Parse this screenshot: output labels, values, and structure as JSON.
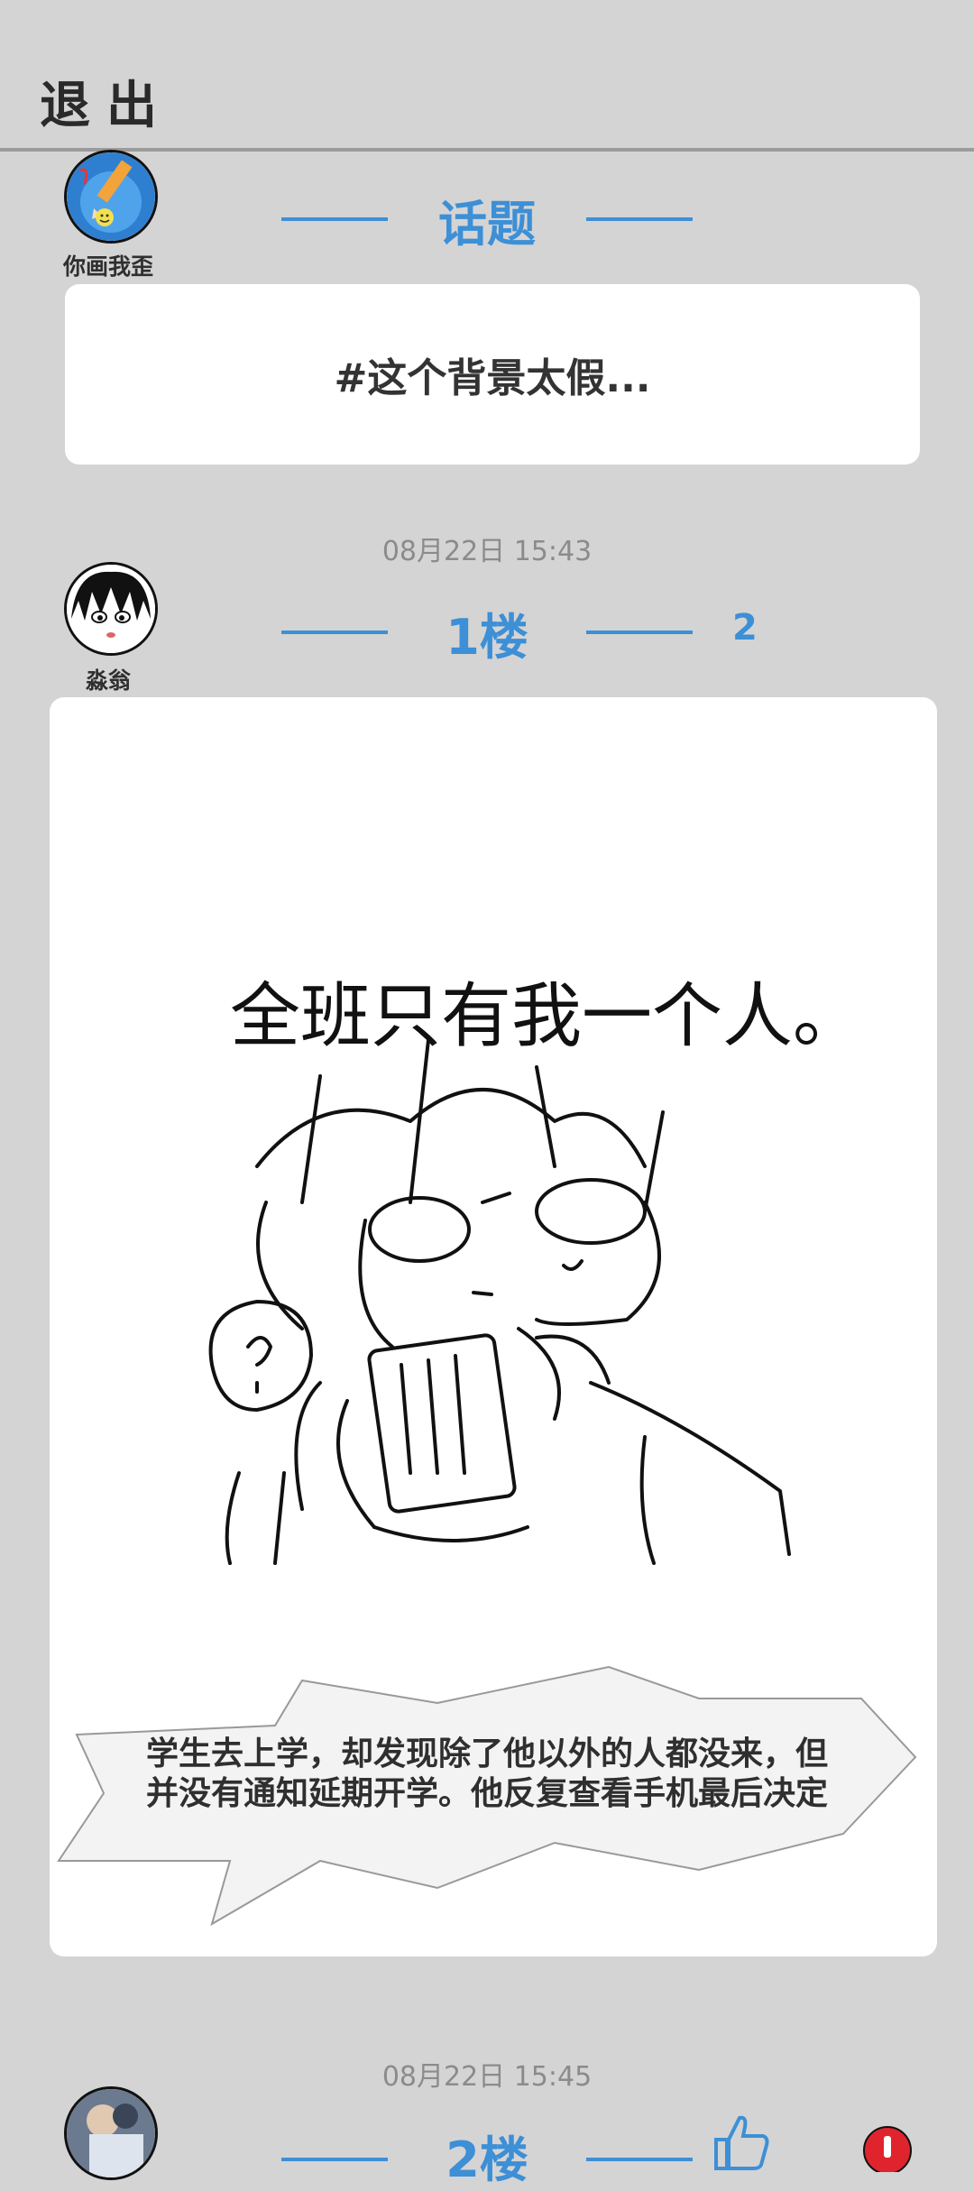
{
  "topbar": {
    "exit_label": "退出"
  },
  "topic_section": {
    "author_name": "你画我歪",
    "heading": "话题",
    "topic_text": "#这个背景太假..."
  },
  "posts": [
    {
      "timestamp": "08月22日  15:43",
      "author_name": "淼翁",
      "floor_label": "1楼",
      "reply_count": "2",
      "drawing": {
        "handwritten_text": "全班只有我一个人。",
        "caption": "学生去上学，却发现除了他以外的人都没来，但并没有通知延期开学。他反复查看手机最后决定"
      }
    },
    {
      "timestamp": "08月22日  15:45",
      "floor_label": "2楼"
    }
  ],
  "icons": {
    "like": "thumbs-up-icon",
    "alert": "alert-icon"
  },
  "colors": {
    "accent": "#3d8fd6",
    "background": "#d4d4d4",
    "card": "#ffffff",
    "alert": "#e0242e"
  }
}
